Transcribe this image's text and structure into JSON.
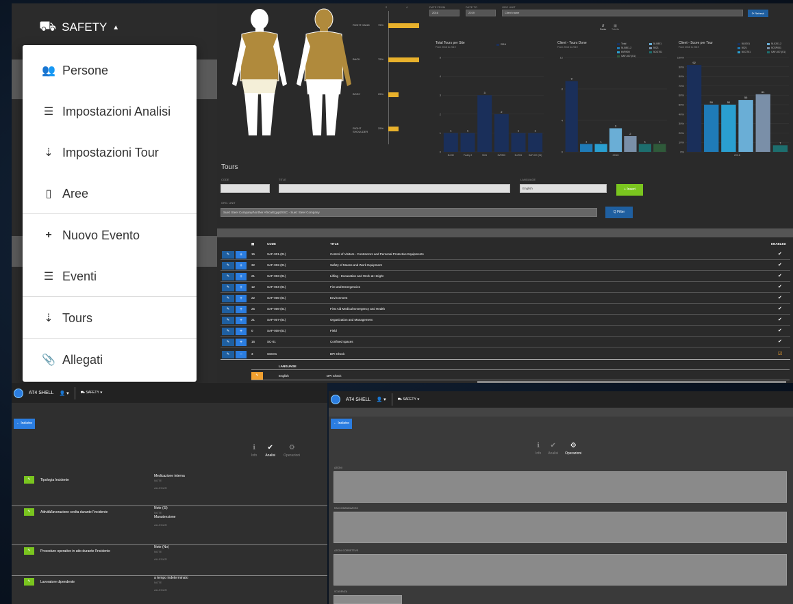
{
  "nav": {
    "module_label": "SAFETY",
    "module_icon": "ambulance-icon"
  },
  "menu": {
    "items": [
      {
        "label": "Persone",
        "icon": "users-icon"
      },
      {
        "label": "Impostazioni Analisi",
        "icon": "list-icon"
      },
      {
        "label": "Impostazioni Tour",
        "icon": "sort-icon"
      },
      {
        "label": "Aree",
        "icon": "building-icon"
      },
      {
        "label": "Nuovo Evento",
        "icon": "plus-icon"
      },
      {
        "label": "Eventi",
        "icon": "list-icon"
      },
      {
        "label": "Tours",
        "icon": "sort-icon"
      },
      {
        "label": "Allegati",
        "icon": "paperclip-icon"
      }
    ]
  },
  "body_map": {
    "rows": [
      {
        "label": "RIGHT HAND",
        "pct": "75%",
        "value": 75
      },
      {
        "label": "BACK",
        "pct": "75%",
        "value": 75
      },
      {
        "label": "BODY",
        "pct": "25%",
        "value": 25
      },
      {
        "label": "RIGHT SHOULDER",
        "pct": "25%",
        "value": 25
      }
    ],
    "axis": [
      "2",
      "4"
    ],
    "tabs": [
      "Radar",
      "Tabella"
    ]
  },
  "filters": {
    "date_from_label": "DATE FROM",
    "date_from": "2016",
    "date_to_label": "DATE TO",
    "date_to": "2019",
    "org_unit_label": "ORG UNIT",
    "org_unit": "Client name",
    "refresh_label": "⟳ Refresh"
  },
  "chart_data": [
    {
      "type": "bar",
      "title": "Total Tours per Site",
      "subtitle": "From 2016 to 2019",
      "legend": [
        "2016"
      ],
      "categories": [
        "5LX50",
        "Poultry 2",
        "5021",
        "6VR900",
        "5L2901",
        "SAF-007-(01)"
      ],
      "values": [
        1,
        1,
        3,
        2,
        1,
        1
      ],
      "ylim": [
        0,
        5
      ],
      "yticks": [
        "0",
        "1",
        "2",
        "3",
        "4",
        "5"
      ],
      "colors": [
        "#1a2f5a"
      ]
    },
    {
      "type": "bar",
      "title": "Client - Tours Done",
      "subtitle": "From 2016 to 2019",
      "legend": [
        "Total",
        "5LX801-2",
        "6VR900",
        "SAF-007-(01)",
        "5LX801",
        "5021",
        "5CO701"
      ],
      "categories": [
        "2016"
      ],
      "series": [
        {
          "name": "Total",
          "values": [
            9
          ]
        },
        {
          "name": "5LX801-2",
          "values": [
            1
          ]
        },
        {
          "name": "6VR900",
          "values": [
            1
          ]
        },
        {
          "name": "5LX801",
          "values": [
            3
          ]
        },
        {
          "name": "5021",
          "values": [
            2
          ]
        },
        {
          "name": "5CO701",
          "values": [
            1
          ]
        },
        {
          "name": "SAF-007-(01)",
          "values": [
            1
          ]
        }
      ],
      "ylim": [
        0,
        12
      ],
      "yticks": [
        "0",
        "4",
        "8",
        "12"
      ],
      "colors": [
        "#1a2f5a",
        "#1f7bb8",
        "#2a9fd0",
        "#6aaed6",
        "#7a8fa8",
        "#1d6e6e",
        "#2f5a3a"
      ]
    },
    {
      "type": "bar",
      "title": "Client - Score per Tour",
      "subtitle": "From 2016 to 2019",
      "legend": [
        "5LX201",
        "5021",
        "5CO701",
        "5LX201-2",
        "5CSP001",
        "SAF-007-(01)"
      ],
      "categories": [
        "2016"
      ],
      "series": [
        {
          "name": "5LX201",
          "values": [
            92
          ]
        },
        {
          "name": "5021",
          "values": [
            50
          ]
        },
        {
          "name": "5CO701",
          "values": [
            50
          ]
        },
        {
          "name": "5LX201-2",
          "values": [
            55
          ]
        },
        {
          "name": "5CSP001",
          "values": [
            61
          ]
        },
        {
          "name": "SAF-007-(01)",
          "values": [
            7
          ]
        }
      ],
      "ylim": [
        0,
        100
      ],
      "yticks": [
        "0%",
        "10%",
        "20%",
        "30%",
        "40%",
        "50%",
        "60%",
        "70%",
        "80%",
        "90%",
        "100%"
      ],
      "colors": [
        "#1a2f5a",
        "#1f7bb8",
        "#2a9fd0",
        "#6aaed6",
        "#7a8fa8",
        "#1d6e6e"
      ]
    }
  ],
  "tours": {
    "title": "Tours",
    "code_label": "CODE",
    "title_label": "TITLE",
    "language_label": "LANGUAGE",
    "language_value": "English",
    "insert_label": "+ Insert",
    "org_unit_label": "ORG. UNIT",
    "org_unit_value": "Suez Steel Company/Norther Africa/Egypt/SSC - Suez Steel Company",
    "filter_label": "Q Filter",
    "columns": {
      "count": "▤",
      "code": "CODE",
      "title": "TITLE",
      "enabled": "ENABLED"
    },
    "rows": [
      {
        "count": "15",
        "code": "SAF-001-(01)",
        "title": "Control of Visitors - Contractors and Personal Protective Equipments",
        "enabled": "✔"
      },
      {
        "count": "32",
        "code": "SAF-002-(01)",
        "title": "Safety of Means and Work Equipment",
        "enabled": "✔"
      },
      {
        "count": "21",
        "code": "SAF-003-(01)",
        "title": "Lifting - Excavation and Work at Height",
        "enabled": "✔"
      },
      {
        "count": "12",
        "code": "SAF-004-(01)",
        "title": "Fire and Emergencies",
        "enabled": "✔"
      },
      {
        "count": "22",
        "code": "SAF-005-(01)",
        "title": "Environment",
        "enabled": "✔"
      },
      {
        "count": "25",
        "code": "SAF-006-(01)",
        "title": "First Aid Medical Emergency and Health",
        "enabled": "✔"
      },
      {
        "count": "21",
        "code": "SAF-007-(01)",
        "title": "Organization and Management",
        "enabled": "✔"
      },
      {
        "count": "0",
        "code": "SAF-008-(01)",
        "title": "Field",
        "enabled": "✔"
      },
      {
        "count": "16",
        "code": "SC-01",
        "title": "Confined spaces",
        "enabled": "✔"
      },
      {
        "count": "3",
        "code": "SSC01",
        "title": "DPI Check",
        "enabled": "☑"
      }
    ],
    "sub_language_label": "LANGUAGE",
    "sub_row": {
      "language": "English",
      "title": "DPI Check"
    }
  },
  "bottom_left": {
    "app_name": "AT4 SHELL",
    "user_icon": "user-icon",
    "module": "SAFETY",
    "back_label": "← Indietro",
    "steps": [
      {
        "label": "Info",
        "icon": "info-icon"
      },
      {
        "label": "Analisi",
        "icon": "check-icon"
      },
      {
        "label": "Operazioni",
        "icon": "gear-icon"
      }
    ],
    "rows": [
      {
        "label": "Tipologia Incidente",
        "values": [
          "Medicazione interna",
          "NOTE",
          "",
          "ALLEGATI"
        ]
      },
      {
        "label": "Attività/lavorazione svolta durante l'incidente",
        "values": [
          "Note (Si)",
          "NOTE",
          "Manutenzione",
          "",
          "ALLEGATI"
        ]
      },
      {
        "label": "Procedure operative in atto durante l'incidente",
        "values": [
          "Note (No)",
          "NOTE",
          "",
          "ALLEGATI"
        ]
      },
      {
        "label": "Lavoratore dipendente",
        "values": [
          "a tempo indeterminato",
          "NOTE",
          "",
          "ALLEGATI"
        ]
      }
    ]
  },
  "bottom_right": {
    "app_name": "AT4 SHELL",
    "module": "SAFETY",
    "back_label": "← Indietro",
    "steps": [
      {
        "label": "Info",
        "icon": "info-icon"
      },
      {
        "label": "Analisi",
        "icon": "check-icon"
      },
      {
        "label": "Operazioni",
        "icon": "gear-icon"
      }
    ],
    "fields": [
      "AZIONI",
      "RACCOMANDAZIONI",
      "AZIONI CORRETTIVE",
      "SCADENZA"
    ]
  }
}
